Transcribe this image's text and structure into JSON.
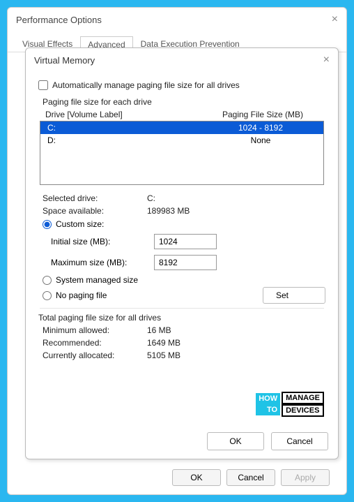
{
  "parent": {
    "title": "Performance Options",
    "tabs": [
      "Visual Effects",
      "Advanced",
      "Data Execution Prevention"
    ],
    "active_tab": 1,
    "buttons": {
      "ok": "OK",
      "cancel": "Cancel",
      "apply": "Apply"
    }
  },
  "vm": {
    "title": "Virtual Memory",
    "auto_label": "Automatically manage paging file size for all drives",
    "auto_checked": false,
    "group_title": "Paging file size for each drive",
    "header_drive": "Drive  [Volume Label]",
    "header_size": "Paging File Size (MB)",
    "drives": [
      {
        "name": "C:",
        "size": "1024 - 8192",
        "selected": true
      },
      {
        "name": "D:",
        "size": "None",
        "selected": false
      }
    ],
    "selected_drive_label": "Selected drive:",
    "selected_drive_value": "C:",
    "space_label": "Space available:",
    "space_value": "189983 MB",
    "radio_custom": "Custom size:",
    "initial_label": "Initial size (MB):",
    "initial_value": "1024",
    "max_label": "Maximum size (MB):",
    "max_value": "8192",
    "radio_system": "System managed size",
    "radio_none": "No paging file",
    "set_button": "Set",
    "total_title": "Total paging file size for all drives",
    "min_label": "Minimum allowed:",
    "min_value": "16 MB",
    "rec_label": "Recommended:",
    "rec_value": "1649 MB",
    "cur_label": "Currently allocated:",
    "cur_value": "5105 MB",
    "ok": "OK",
    "cancel": "Cancel"
  },
  "watermark": {
    "how": "HOW",
    "to": "TO",
    "manage": "MANAGE",
    "devices": "DEVICES"
  }
}
